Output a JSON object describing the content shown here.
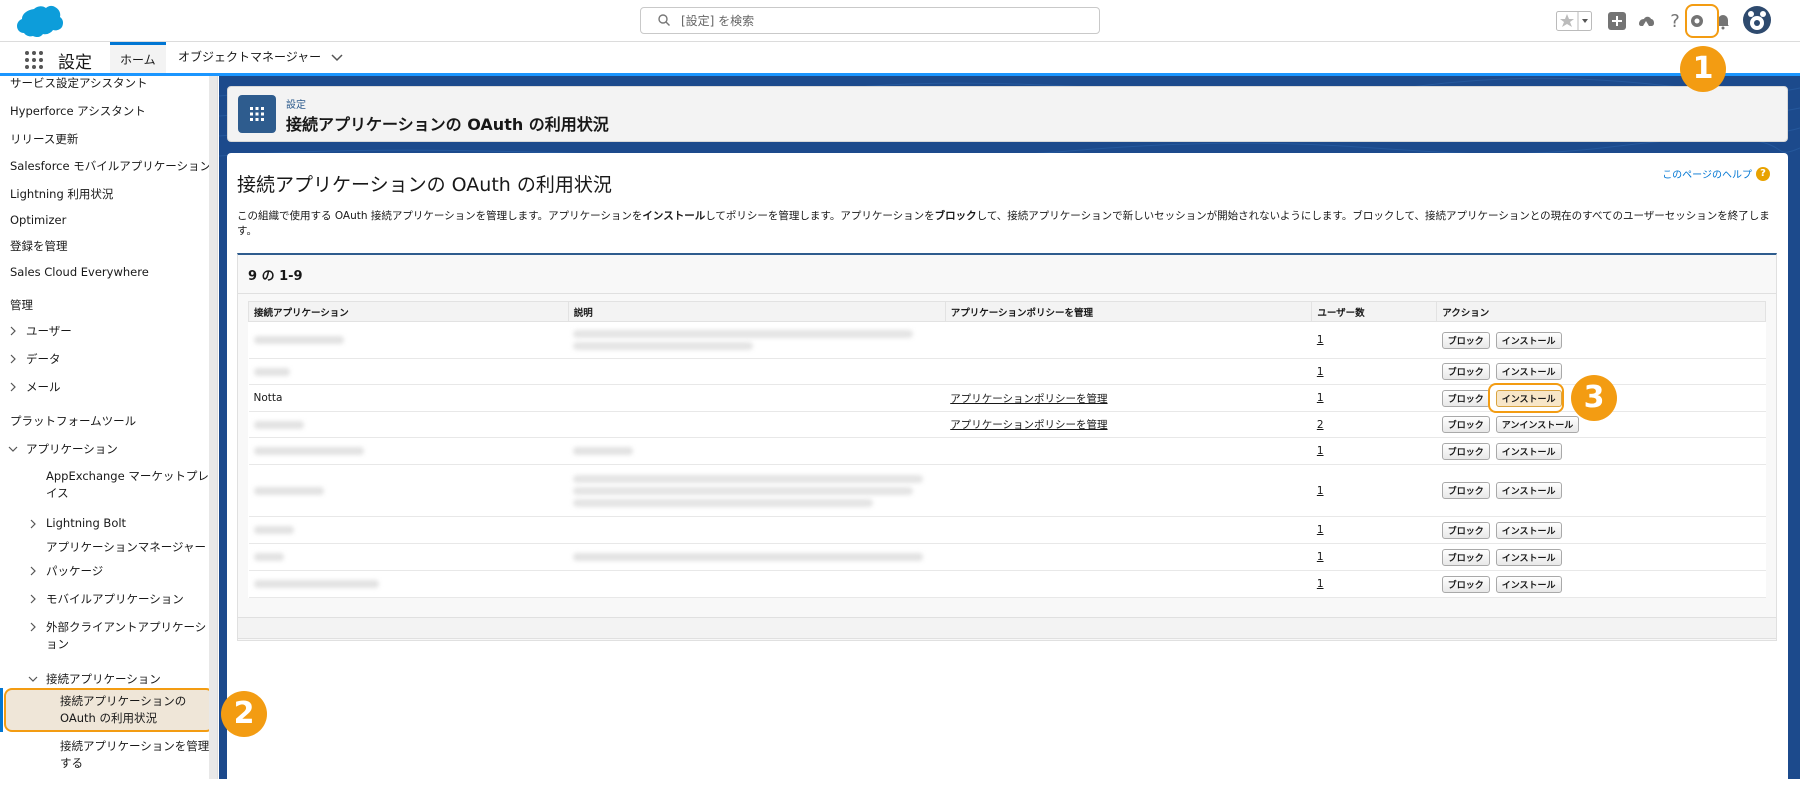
{
  "search": {
    "placeholder": "[設定] を検索"
  },
  "nav": {
    "app_name": "設定",
    "tab_home": "ホーム",
    "tab_object_manager": "オブジェクトマネージャー"
  },
  "sidebar": {
    "items": [
      "サービス設定アシスタント",
      "Hyperforce アシスタント",
      "リリース更新",
      "Salesforce モバイルアプリケーション",
      "Lightning 利用状況",
      "Optimizer",
      "登録を管理",
      "Sales Cloud Everywhere"
    ],
    "section_admin": "管理",
    "admin_items": [
      "ユーザー",
      "データ",
      "メール"
    ],
    "section_platform": "プラットフォームツール",
    "apps_label": "アプリケーション",
    "apps_children": [
      "AppExchange マーケットプレイス",
      "Lightning Bolt",
      "アプリケーションマネージャー",
      "パッケージ",
      "モバイルアプリケーション",
      "外部クライアントアプリケーション"
    ],
    "connected_apps_label": "接続アプリケーション",
    "connected_children": [
      "接続アプリケーションの OAuth の利用状況",
      "接続アプリケーションを管理する"
    ]
  },
  "header": {
    "breadcrumb": "設定",
    "title": "接続アプリケーションの OAuth の利用状況"
  },
  "content": {
    "title": "接続アプリケーションの OAuth の利用状況",
    "help": "このページのヘルプ",
    "desc_1": "この組織で使用する OAuth 接続アプリケーションを管理します。アプリケーションを",
    "desc_install": "インストール",
    "desc_2": "してポリシーを管理します。アプリケーションを",
    "desc_block": "ブロック",
    "desc_3": "して、接続アプリケーションで新しいセッションが開始されないようにします。ブロックして、接続アプリケーションとの現在のすべてのユーザーセッションを終了します。"
  },
  "list": {
    "count": "9 の 1-9",
    "columns": [
      "接続アプリケーション",
      "説明",
      "アプリケーションポリシーを管理",
      "ユーザー数",
      "アクション"
    ],
    "rows": [
      {
        "name": "",
        "policy": "",
        "users": "1",
        "block": "ブロック",
        "install": "インストール"
      },
      {
        "name": "",
        "policy": "",
        "users": "1",
        "block": "ブロック",
        "install": "インストール"
      },
      {
        "name": "Notta",
        "policy": "アプリケーションポリシーを管理",
        "users": "1",
        "block": "ブロック",
        "install": "インストール"
      },
      {
        "name": "",
        "policy": "アプリケーションポリシーを管理",
        "users": "2",
        "block": "ブロック",
        "install": "アンインストール"
      },
      {
        "name": "",
        "policy": "",
        "users": "1",
        "block": "ブロック",
        "install": "インストール"
      },
      {
        "name": "",
        "policy": "",
        "users": "1",
        "block": "ブロック",
        "install": "インストール"
      },
      {
        "name": "",
        "policy": "",
        "users": "1",
        "block": "ブロック",
        "install": "インストール"
      },
      {
        "name": "",
        "policy": "",
        "users": "1",
        "block": "ブロック",
        "install": "インストール"
      },
      {
        "name": "",
        "policy": "",
        "users": "1",
        "block": "ブロック",
        "install": "インストール"
      }
    ]
  },
  "callouts": {
    "one": "1",
    "two": "2",
    "three": "3"
  },
  "colors": {
    "accent": "#f39c12",
    "brand_blue": "#0176d3",
    "header_bg": "#1c4a8c"
  }
}
